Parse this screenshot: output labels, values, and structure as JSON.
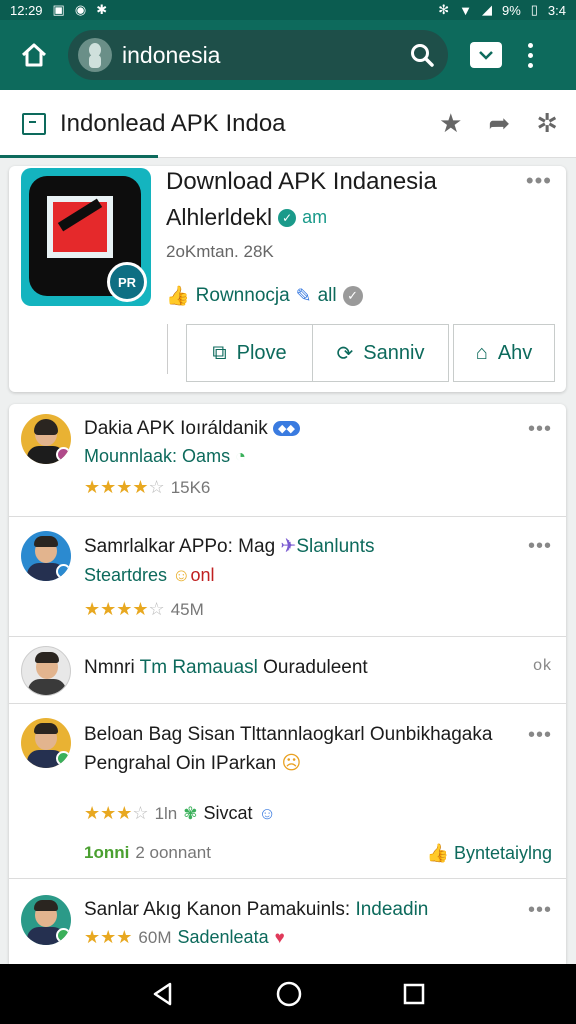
{
  "status_bar": {
    "time": "12:29",
    "battery": "9%",
    "clock_right": "3:4"
  },
  "browser": {
    "url": "indonesia"
  },
  "header": {
    "title": "Indonlead APK Indoa"
  },
  "app": {
    "title": "Download APK Indanesia",
    "developer": "Alhlerldekl",
    "tag": "am",
    "meta": "2oKmtan. 28K",
    "recommend": "Rownnocja",
    "recommend_tail": "all",
    "buttons": [
      {
        "label": "Plove",
        "icon": "install-icon"
      },
      {
        "label": "Sanniv",
        "icon": "share-icon"
      },
      {
        "label": "Ahv",
        "icon": "home-icon"
      }
    ]
  },
  "feed": [
    {
      "title": "Dakia APK Ioıráldanik",
      "sub": "Mounnlaak: Oams",
      "rating": 3.5,
      "count": "15K6",
      "accent": "#e9b233",
      "mark": "#b04a8a"
    },
    {
      "title": "Samrlalkar APPo: Mag",
      "title_tail": "Slanlunts",
      "sub": "Steartdres",
      "sub_tail": "onl",
      "rating": 3.5,
      "count": "45M",
      "accent": "#2b8ad0",
      "mark": "#2b8ad0"
    },
    {
      "title": "Nmnri",
      "title_mid": "Tm Ramauasl",
      "title_tail": "Ouraduleent",
      "action": "ok",
      "accent": "#e0e0e0",
      "mark": "#ffffff"
    },
    {
      "title": "Beloan Bag Sisan Tlttannlaogkarl Ounbikhagaka",
      "sub2": "Pengrahal Oin IParkan",
      "rating": 2.5,
      "count": "1ln",
      "tag": "Sivcat",
      "follow": "1onni",
      "follow_count": "2 oonnant",
      "link": "Byntetaiylng",
      "accent": "#e9b233",
      "mark": "#3ab05a"
    },
    {
      "title": "Sanlar Akıg Kanon Pamakuinls:",
      "title_tail": "Indeadin",
      "rating": 3,
      "count": "60M",
      "tag": "Sadenleata",
      "accent": "#2b9a88",
      "mark": "#2b9a88"
    }
  ]
}
